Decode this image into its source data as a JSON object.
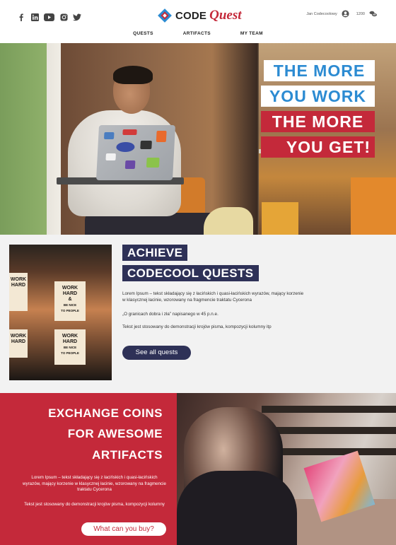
{
  "header": {
    "social_icons": [
      "facebook-icon",
      "linkedin-icon",
      "youtube-icon",
      "instagram-icon",
      "twitter-icon"
    ],
    "logo": {
      "part1": "CODE",
      "part2": "Quest"
    },
    "user": {
      "name": "Jan Codecoolowy",
      "coins": "1200"
    },
    "nav": [
      "QUESTS",
      "ARTIFACTS",
      "MY TEAM"
    ]
  },
  "hero": {
    "lines": [
      {
        "text": "THE MORE",
        "style": "blue"
      },
      {
        "text": "YOU WORK",
        "style": "blue"
      },
      {
        "text": "THE MORE",
        "style": "red"
      },
      {
        "text": "YOU GET!",
        "style": "red"
      }
    ]
  },
  "quests": {
    "heading_line1": "ACHIEVE",
    "heading_line2": "CODECOOL QUESTS",
    "paragraph1": "Lorem Ipsum – tekst składający się z łacińskich i quasi-łacińskich wyrazów, mający korzenie w klasycznej łacinie, wzorowany na fragmencie traktatu Cycerona",
    "paragraph2": "„O granicach dobra i zła” napisanego w 45 p.n.e.",
    "paragraph3": "Tekst jest stosowany do demonstracji krojów pisma, kompozycji kolumny itp",
    "button": "See all quests",
    "poster_text": [
      "WORK",
      "HARD",
      "&",
      "BE NICE",
      "TO PEOPLE"
    ]
  },
  "coins": {
    "heading_line1": "EXCHANGE COINS",
    "heading_line2": "FOR AWESOME",
    "heading_line3": "ARTIFACTS",
    "paragraph1": "Lorem Ipsum – tekst składający się z łacińskich i quasi-łacińskich wyrazów, mający korzenie w klasycznej łacinie, wzorowany na fragmencie traktatu Cycerona",
    "paragraph2": "Tekst jest stosowany do demonstracji krojów pisma, kompozycji kolumny",
    "button": "What can you buy?"
  },
  "colors": {
    "red": "#c4293a",
    "navy": "#2e3157",
    "blue": "#2c8bd2"
  }
}
